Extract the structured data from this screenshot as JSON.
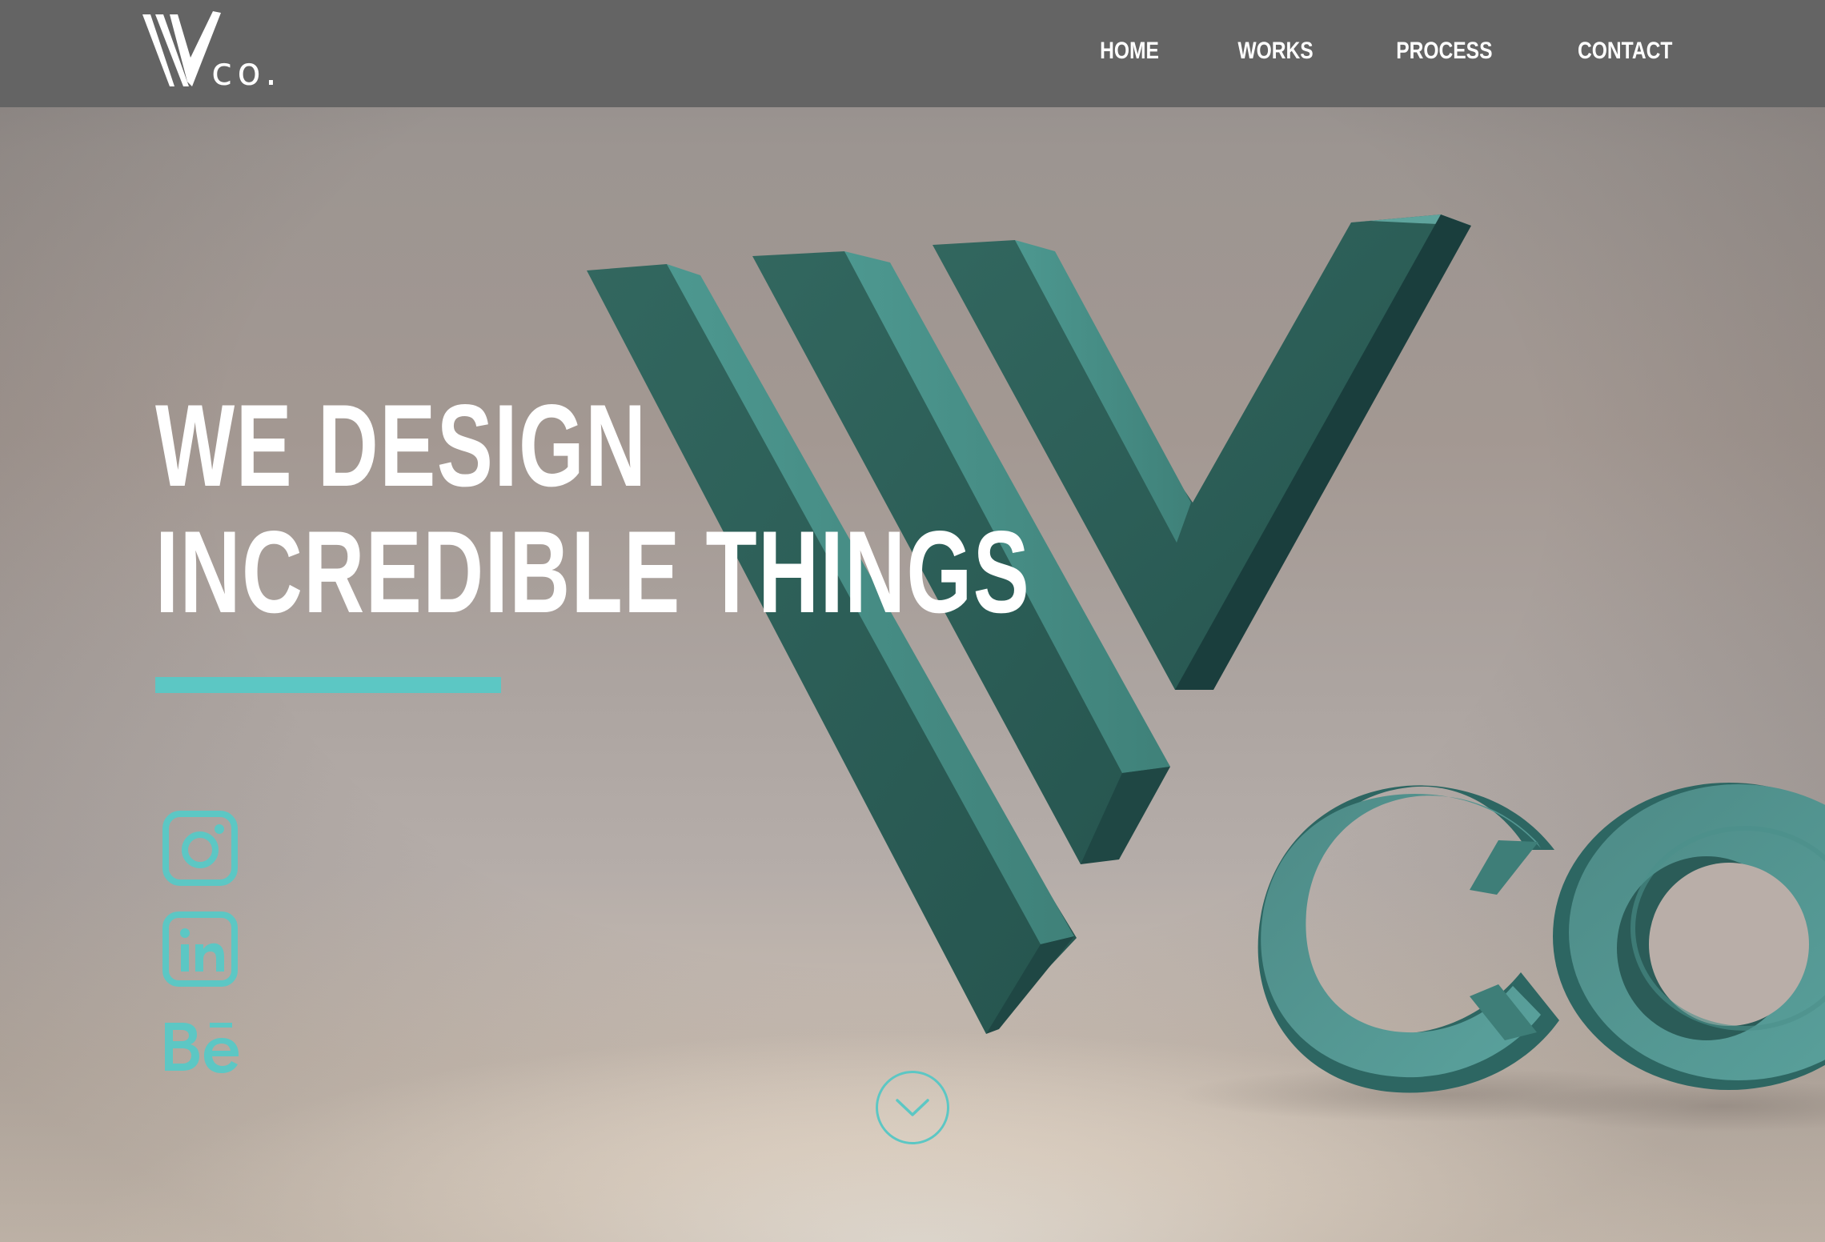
{
  "header": {
    "logo_text": "co.",
    "nav": {
      "home": "HOME",
      "works": "WORKS",
      "process": "PROCESS",
      "contact": "CONTACT"
    }
  },
  "hero": {
    "line1": "WE DESIGN",
    "line2": "INCREDIBLE THINGS"
  },
  "social": [
    "instagram-icon",
    "linkedin-icon",
    "behance-icon"
  ],
  "colors": {
    "topbar": "#646464",
    "accent": "#5cc7c4",
    "teal_dark": "#2f615d",
    "teal_mid": "#3f7a74",
    "teal_light": "#5fa49d"
  },
  "scroll_button_icon": "chevron-down-icon"
}
